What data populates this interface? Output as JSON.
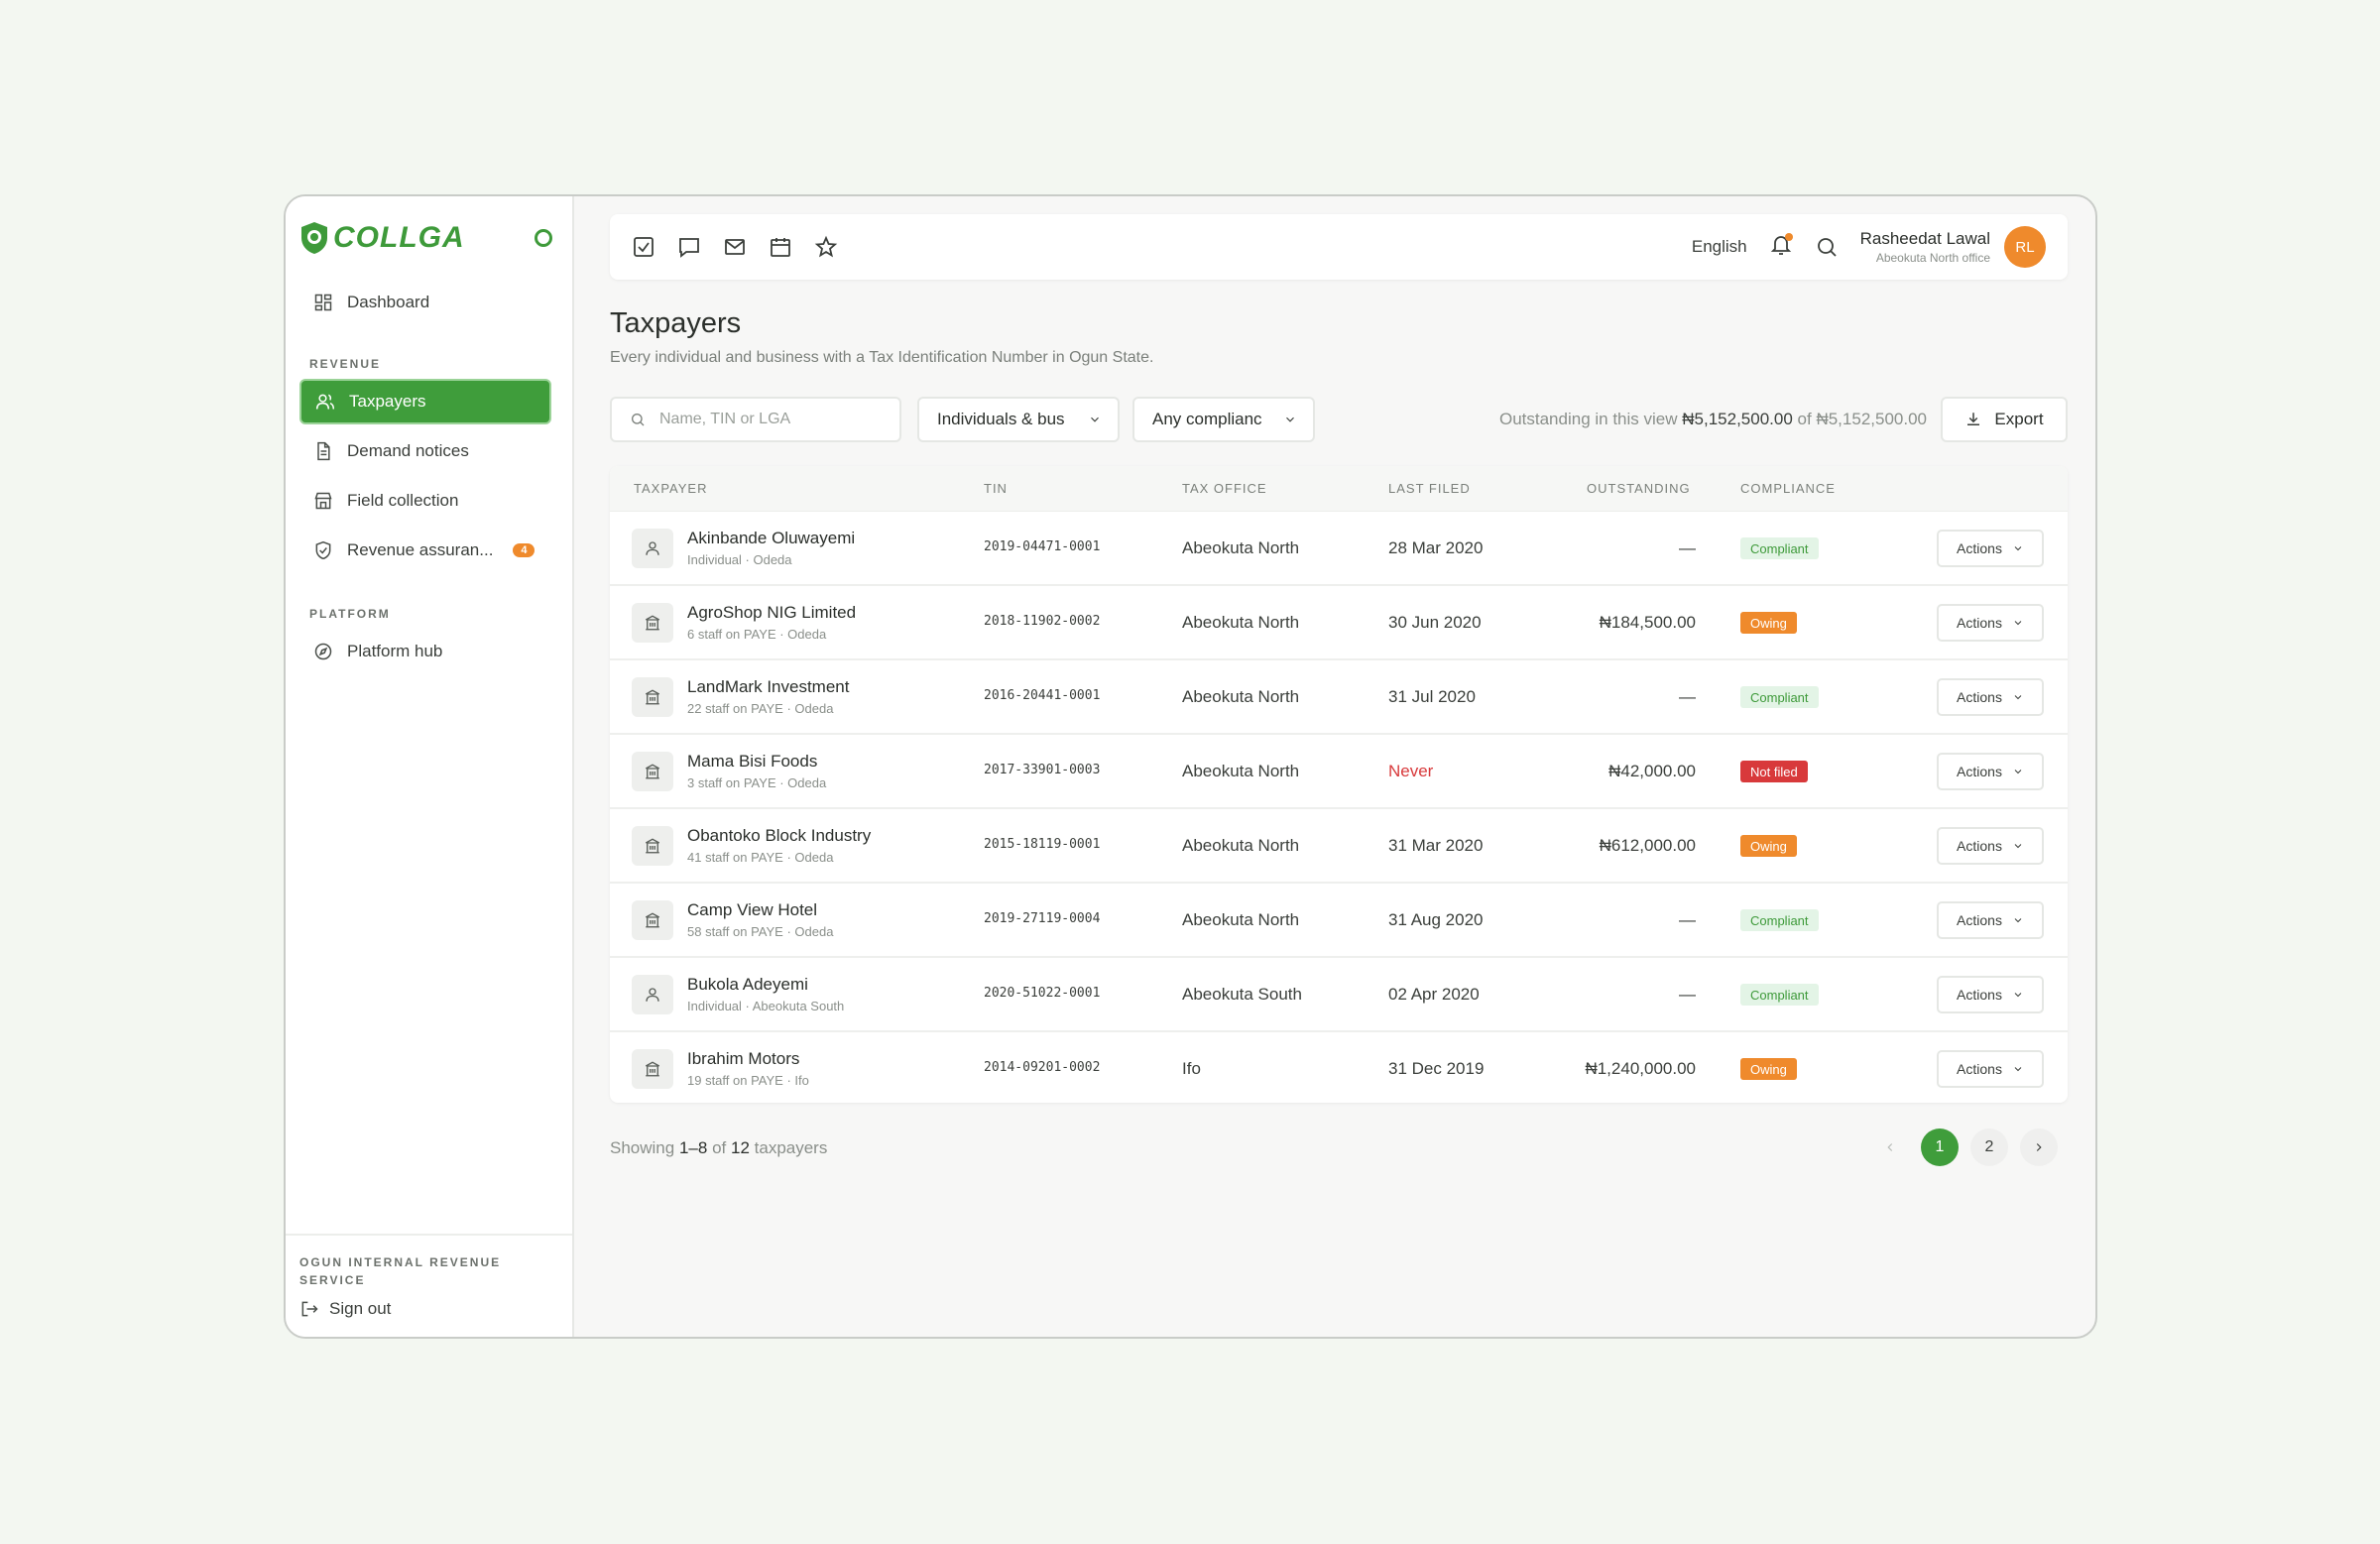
{
  "brand": {
    "name": "COLLGA",
    "accent": "#3e9a3a"
  },
  "sidebar": {
    "dashboard": "Dashboard",
    "section_revenue": "REVENUE",
    "items": [
      {
        "label": "Taxpayers",
        "icon": "users-icon",
        "active": true
      },
      {
        "label": "Demand notices",
        "icon": "document-icon"
      },
      {
        "label": "Field collection",
        "icon": "store-icon"
      },
      {
        "label": "Revenue assuran...",
        "icon": "shield-check-icon",
        "badge": "4"
      }
    ],
    "section_platform": "PLATFORM",
    "platform_hub": "Platform hub",
    "org": "OGUN INTERNAL REVENUE SERVICE",
    "sign_out": "Sign out"
  },
  "topbar": {
    "language": "English",
    "user_name": "Rasheedat Lawal",
    "user_office": "Abeokuta North office",
    "avatar_initials": "RL"
  },
  "page": {
    "title": "Taxpayers",
    "subtitle": "Every individual and business with a Tax Identification Number in Ogun State."
  },
  "filters": {
    "search_placeholder": "Name, TIN or LGA",
    "type_value": "Individuals & bus",
    "compliance_value": "Any complianc",
    "outstanding_prefix": "Outstanding in this view",
    "outstanding_view": "₦5,152,500.00",
    "outstanding_of": "of",
    "outstanding_total": "₦5,152,500.00",
    "export": "Export"
  },
  "table": {
    "headers": [
      "TAXPAYER",
      "TIN",
      "TAX OFFICE",
      "LAST FILED",
      "OUTSTANDING",
      "COMPLIANCE"
    ],
    "actions_label": "Actions",
    "rows": [
      {
        "name": "Akinbande Oluwayemi",
        "meta": "Individual · Odeda",
        "tin": "2019-04471-0001",
        "office": "Abeokuta North",
        "filed": "28 Mar 2020",
        "amount": "—",
        "status": "Compliant",
        "kind": "person"
      },
      {
        "name": "AgroShop NIG Limited",
        "meta": "6 staff on PAYE · Odeda",
        "tin": "2018-11902-0002",
        "office": "Abeokuta North",
        "filed": "30 Jun 2020",
        "amount": "₦184,500.00",
        "status": "Owing",
        "kind": "business"
      },
      {
        "name": "LandMark Investment",
        "meta": "22 staff on PAYE · Odeda",
        "tin": "2016-20441-0001",
        "office": "Abeokuta North",
        "filed": "31 Jul 2020",
        "amount": "—",
        "status": "Compliant",
        "kind": "business"
      },
      {
        "name": "Mama Bisi Foods",
        "meta": "3 staff on PAYE · Odeda",
        "tin": "2017-33901-0003",
        "office": "Abeokuta North",
        "filed": "Never",
        "amount": "₦42,000.00",
        "status": "Not filed",
        "kind": "business"
      },
      {
        "name": "Obantoko Block Industry",
        "meta": "41 staff on PAYE · Odeda",
        "tin": "2015-18119-0001",
        "office": "Abeokuta North",
        "filed": "31 Mar 2020",
        "amount": "₦612,000.00",
        "status": "Owing",
        "kind": "business"
      },
      {
        "name": "Camp View Hotel",
        "meta": "58 staff on PAYE · Odeda",
        "tin": "2019-27119-0004",
        "office": "Abeokuta North",
        "filed": "31 Aug 2020",
        "amount": "—",
        "status": "Compliant",
        "kind": "business"
      },
      {
        "name": "Bukola Adeyemi",
        "meta": "Individual · Abeokuta South",
        "tin": "2020-51022-0001",
        "office": "Abeokuta South",
        "filed": "02 Apr 2020",
        "amount": "—",
        "status": "Compliant",
        "kind": "person"
      },
      {
        "name": "Ibrahim Motors",
        "meta": "19 staff on PAYE · Ifo",
        "tin": "2014-09201-0002",
        "office": "Ifo",
        "filed": "31 Dec 2019",
        "amount": "₦1,240,000.00",
        "status": "Owing",
        "kind": "business"
      }
    ]
  },
  "footer": {
    "showing_prefix": "Showing",
    "showing_range": "1–8",
    "showing_of": "of",
    "showing_total": "12",
    "showing_suffix": "taxpayers",
    "pages": [
      "1",
      "2"
    ]
  }
}
